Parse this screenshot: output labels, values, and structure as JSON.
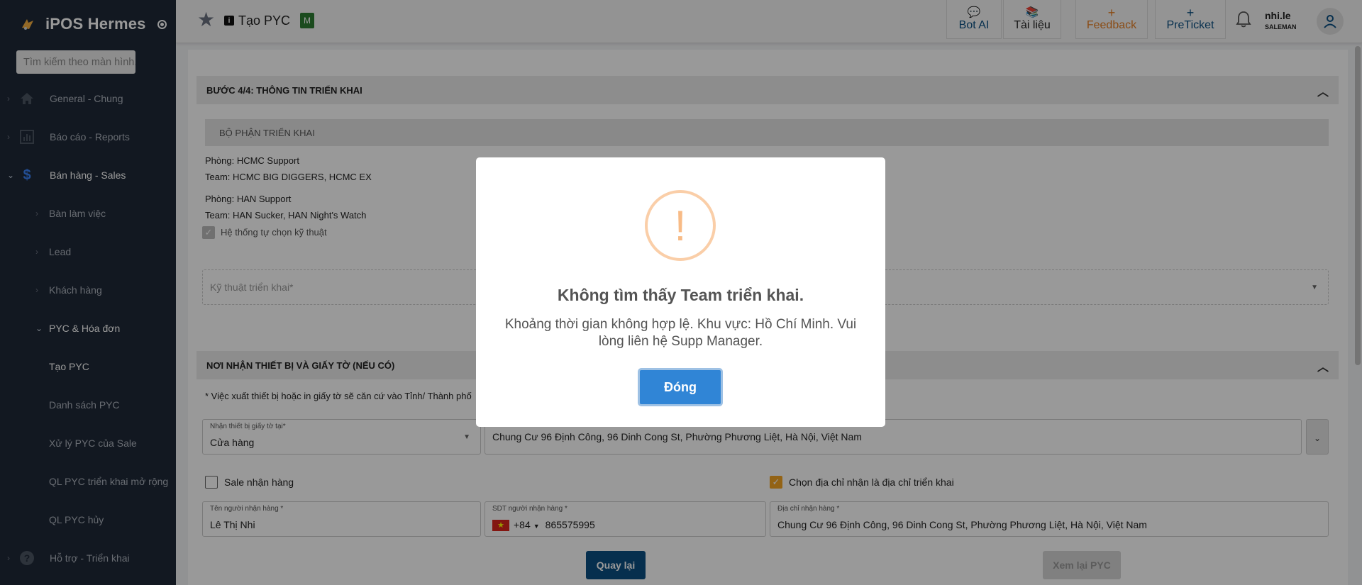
{
  "app": {
    "name": "iPOS Hermes"
  },
  "sidebar": {
    "search_placeholder": "Tìm kiếm theo màn hình...",
    "items": [
      {
        "label": "General - Chung"
      },
      {
        "label": "Báo cáo - Reports"
      },
      {
        "label": "Bán hàng - Sales"
      },
      {
        "label": "Bàn làm việc"
      },
      {
        "label": "Lead"
      },
      {
        "label": "Khách hàng"
      },
      {
        "label": "PYC & Hóa đơn"
      },
      {
        "label": "Tạo PYC"
      },
      {
        "label": "Danh sách PYC"
      },
      {
        "label": "Xử lý PYC của Sale"
      },
      {
        "label": "QL PYC triển khai mở rộng"
      },
      {
        "label": "QL PYC hủy"
      },
      {
        "label": "Hỗ trợ - Triển khai"
      }
    ]
  },
  "header": {
    "title": "Tạo PYC",
    "badge": "M",
    "buttons": {
      "bot_ai": "Bot AI",
      "docs": "Tài liệu",
      "feedback": "Feedback",
      "preticket": "PreTicket"
    },
    "user": {
      "name": "nhi.le",
      "role": "SALEMAN"
    }
  },
  "step": {
    "title": "BƯỚC 4/4: THÔNG TIN TRIỂN KHAI",
    "subhead": "BỘ PHẬN TRIỂN KHAI",
    "dept1": "Phòng: HCMC Support",
    "team1": "Team: HCMC BIG DIGGERS, HCMC EX",
    "dept2": "Phòng: HAN Support",
    "team2": "Team: HAN Sucker, HAN Night's Watch",
    "auto_select": "Hệ thống tự chọn kỹ thuật",
    "tech_placeholder": "Kỹ thuật triển khai*"
  },
  "receive": {
    "title": "NƠI NHẬN THIẾT BỊ VÀ GIẤY TỜ (NẾU CÓ)",
    "note": "* Việc xuất thiết bị hoặc in giấy tờ sẽ căn cứ vào Tỉnh/ Thành phố",
    "location_label": "Nhận thiết bị giấy tờ tại*",
    "location_value": "Cửa hàng",
    "address_value": "Chung Cư 96 Định Công, 96 Dinh Cong St, Phường Phương Liệt, Hà Nội, Việt Nam",
    "sale_receive": "Sale nhận hàng",
    "use_deploy_address": "Chọn địa chỉ nhận là địa chỉ triển khai",
    "receiver_name_label": "Tên người nhận hàng *",
    "receiver_name": "Lê Thị Nhi",
    "phone_label": "SDT người nhận hàng *",
    "phone_code": "+84",
    "phone": "865575995",
    "receive_address_label": "Địa chỉ nhận hàng *",
    "receive_address": "Chung Cư 96 Định Công, 96 Dinh Cong St, Phường Phương Liệt, Hà Nội, Việt Nam"
  },
  "footer": {
    "back": "Quay lại",
    "review": "Xem lại PYC"
  },
  "modal": {
    "title": "Không tìm thấy Team triển khai.",
    "message": "Khoảng thời gian không hợp lệ. Khu vực: Hồ Chí Minh. Vui lòng liên hệ Supp Manager.",
    "button": "Đóng"
  },
  "colors": {
    "sidebar_bg": "#1f2937",
    "primary": "#0b4f82",
    "modal_button": "#3085d6",
    "warning": "#f8bb86",
    "accent": "#f5a623"
  }
}
